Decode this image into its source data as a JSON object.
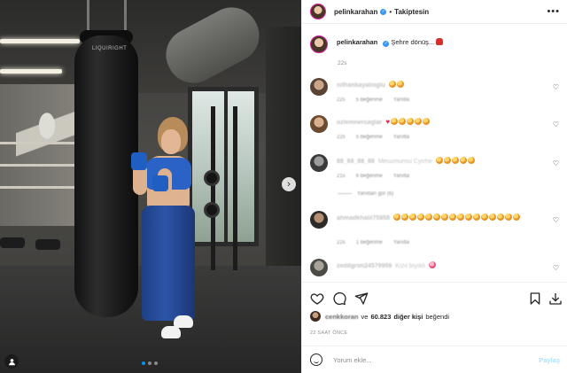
{
  "header": {
    "username": "pelinkarahan",
    "separator": "•",
    "follow_label": "Takiptesin",
    "more_label": "•••"
  },
  "caption": {
    "username": "pelinkarahan",
    "text": "Şehre dönüş...",
    "emoji": "boxing-glove",
    "time": "22s"
  },
  "comments": [
    {
      "username": "nilhankayalioglu",
      "text_emojis": 2,
      "time": "22s",
      "likes": "5 beğenme",
      "reply": "Yanıtla"
    },
    {
      "username": "ozlemnercaglar",
      "text_emojis": 6,
      "time": "22s",
      "likes": "5 beğenme",
      "reply": "Yanıtla"
    },
    {
      "username": "88_88_88_88",
      "text": "Mesumunsu Cyrrhe",
      "text_emojis": 5,
      "time": "21s",
      "likes": "6 beğenme",
      "reply": "Yanıtla"
    },
    {
      "username": "ahmadkhalil75958",
      "text_emojis": 16,
      "time": "22s",
      "likes": "1 beğenme",
      "reply": "Yanıtla"
    },
    {
      "username": "zeddgrim24579959",
      "text": "Kızıl bıyıklı",
      "text_emojis": 1,
      "time": "22s",
      "likes": "",
      "reply": ""
    }
  ],
  "view_replies": "Yanıtları gör (6)",
  "likes": {
    "first_user": "cenkkoran",
    "connector": "ve",
    "count": "60.823",
    "others": "diğer kişi",
    "suffix": "beğendi"
  },
  "post_age": "22 SAAT ÖNCE",
  "comment_box": {
    "placeholder": "Yorum ekle...",
    "post_label": "Paylaş"
  },
  "photo": {
    "bag_logo": "LIQUIRIGHT",
    "carousel_pages": 3,
    "carousel_active": 1
  },
  "colors": {
    "accent": "#0095f6",
    "verified": "#3897f0",
    "story_ring": "#d6249f",
    "text": "#262626",
    "muted": "#8e8e8e",
    "post_button_disabled": "#b2dffc"
  }
}
